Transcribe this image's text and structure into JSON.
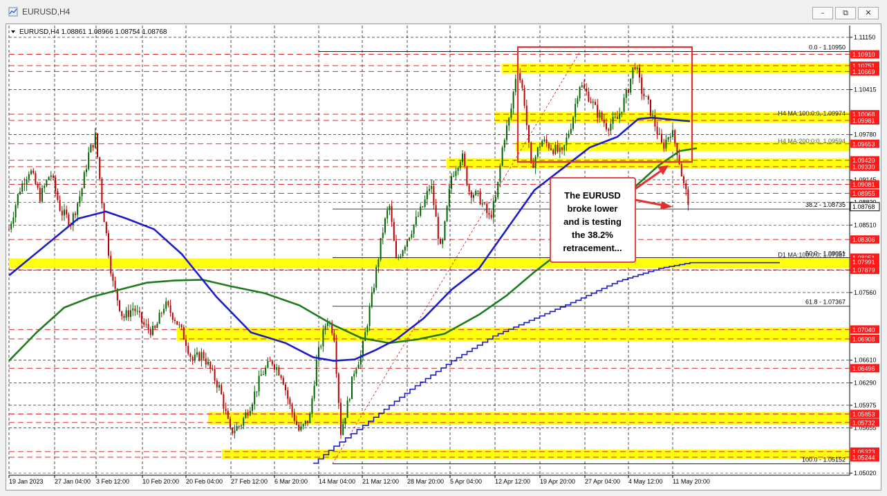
{
  "window": {
    "title": "EURUSD,H4",
    "minimize_label": "–",
    "restore_label": "⧉",
    "close_label": "✕"
  },
  "chart_data": {
    "type": "candlestick",
    "symbol_header": "EURUSD,H4  1.08861 1.08966 1.08754 1.08768",
    "ylim": [
      1.0502,
      1.1111
    ],
    "colors": {
      "up": "#006400",
      "down": "#c00000",
      "ma100": "#1c1cc8",
      "ma200": "#1e7a1e",
      "d1_ma100": "#1c1cc8",
      "zone": "#ffff00",
      "box": "#e03030",
      "arrow": "#e03030"
    },
    "y_ticks": [
      "1.11150",
      "1.10415",
      "1.09780",
      "1.09145",
      "1.08830",
      "1.08510",
      "1.07875",
      "1.07560",
      "1.06610",
      "1.06290",
      "1.05975",
      "1.05655",
      "1.05020"
    ],
    "x_ticks": [
      "19 Jan 2023",
      "27 Jan 04:00",
      "3 Feb 12:00",
      "10 Feb 20:00",
      "20 Feb 04:00",
      "27 Feb 12:00",
      "6 Mar 20:00",
      "14 Mar 04:00",
      "21 Mar 12:00",
      "28 Mar 20:00",
      "5 Apr 04:00",
      "12 Apr 12:00",
      "19 Apr 20:00",
      "27 Apr 04:00",
      "4 May 12:00",
      "11 May 20:00"
    ],
    "price_labels": [
      {
        "text": "1.10910",
        "kind": "red"
      },
      {
        "text": "1.10751",
        "kind": "red"
      },
      {
        "text": "1.10669",
        "kind": "red"
      },
      {
        "text": "1.10068",
        "kind": "red"
      },
      {
        "text": "1.09981",
        "kind": "red"
      },
      {
        "text": "1.09653",
        "kind": "red"
      },
      {
        "text": "1.09420",
        "kind": "red"
      },
      {
        "text": "1.09330",
        "kind": "red"
      },
      {
        "text": "1.09081",
        "kind": "red"
      },
      {
        "text": "1.08955",
        "kind": "red"
      },
      {
        "text": "1.08768",
        "kind": "current"
      },
      {
        "text": "1.08306",
        "kind": "red"
      },
      {
        "text": "1.08051",
        "kind": "red"
      },
      {
        "text": "1.07991",
        "kind": "red"
      },
      {
        "text": "1.07879",
        "kind": "red"
      },
      {
        "text": "1.07040",
        "kind": "red"
      },
      {
        "text": "1.06908",
        "kind": "red"
      },
      {
        "text": "1.06496",
        "kind": "red"
      },
      {
        "text": "1.05853",
        "kind": "red"
      },
      {
        "text": "1.05732",
        "kind": "red"
      },
      {
        "text": "1.05323",
        "kind": "red"
      },
      {
        "text": "1.05244",
        "kind": "red"
      }
    ],
    "fib_levels": [
      {
        "label": "0.0 - 1.10950",
        "price": 1.1095
      },
      {
        "label": "38.2 - 1.08735",
        "price": 1.08735
      },
      {
        "label": "50.0 - 1.08051",
        "price": 1.08051
      },
      {
        "label": "61.8 - 1.07367",
        "price": 1.07367
      },
      {
        "label": "100.0 - 1.05152",
        "price": 1.05152
      }
    ],
    "ma_labels": {
      "h4_ma100": "H4 MA:100:0:0, 1.09974",
      "h4_ma200": "H4 MA:200:0:0, 1.09594",
      "d1_ma100": "D1 MA:100:0:0, 1.07987"
    },
    "zones": [
      {
        "from": 1.10669,
        "to": 1.10751
      },
      {
        "from": 1.09981,
        "to": 1.10068
      },
      {
        "from": 1.09577,
        "to": 1.09653
      },
      {
        "from": 1.0933,
        "to": 1.0942
      },
      {
        "from": 1.07938,
        "to": 1.0801
      },
      {
        "from": 1.06908,
        "to": 1.0704
      },
      {
        "from": 1.05732,
        "to": 1.05853
      },
      {
        "from": 1.05244,
        "to": 1.05323
      }
    ],
    "red_lines": [
      1.1091,
      1.10751,
      1.10669,
      1.10068,
      1.09981,
      1.09653,
      1.0942,
      1.0933,
      1.09081,
      1.08955,
      1.08306,
      1.07879,
      1.0704,
      1.06908,
      1.06496,
      1.05853,
      1.05732,
      1.05323,
      1.05244
    ],
    "close_path": [
      [
        0,
        1.0845
      ],
      [
        15,
        1.09
      ],
      [
        30,
        1.093
      ],
      [
        45,
        1.089
      ],
      [
        60,
        1.0925
      ],
      [
        75,
        1.087
      ],
      [
        90,
        1.0855
      ],
      [
        105,
        1.09
      ],
      [
        115,
        1.095
      ],
      [
        125,
        1.0975
      ],
      [
        135,
        1.088
      ],
      [
        150,
        1.077
      ],
      [
        165,
        1.072
      ],
      [
        180,
        1.0735
      ],
      [
        195,
        1.071
      ],
      [
        210,
        1.07
      ],
      [
        225,
        1.074
      ],
      [
        240,
        1.072
      ],
      [
        255,
        1.069
      ],
      [
        265,
        1.066
      ],
      [
        280,
        1.067
      ],
      [
        295,
        1.064
      ],
      [
        305,
        1.062
      ],
      [
        320,
        1.056
      ],
      [
        335,
        1.057
      ],
      [
        350,
        1.06
      ],
      [
        365,
        1.064
      ],
      [
        380,
        1.066
      ],
      [
        395,
        1.064
      ],
      [
        405,
        1.06
      ],
      [
        420,
        1.056
      ],
      [
        435,
        1.058
      ],
      [
        445,
        1.066
      ],
      [
        460,
        1.072
      ],
      [
        470,
        1.07
      ],
      [
        480,
        1.056
      ],
      [
        490,
        1.06
      ],
      [
        500,
        1.065
      ],
      [
        510,
        1.067
      ],
      [
        525,
        1.075
      ],
      [
        540,
        1.084
      ],
      [
        550,
        1.088
      ],
      [
        560,
        1.08
      ],
      [
        575,
        1.083
      ],
      [
        590,
        1.086
      ],
      [
        600,
        1.088
      ],
      [
        610,
        1.091
      ],
      [
        625,
        1.081
      ],
      [
        640,
        1.092
      ],
      [
        655,
        1.095
      ],
      [
        665,
        1.09
      ],
      [
        680,
        1.089
      ],
      [
        695,
        1.086
      ],
      [
        705,
        1.089
      ],
      [
        715,
        1.097
      ],
      [
        725,
        1.1005
      ],
      [
        735,
        1.1075
      ],
      [
        745,
        1.103
      ],
      [
        755,
        1.093
      ],
      [
        770,
        1.097
      ],
      [
        785,
        1.096
      ],
      [
        800,
        1.095
      ],
      [
        815,
        1.1
      ],
      [
        825,
        1.105
      ],
      [
        840,
        1.103
      ],
      [
        850,
        1.101
      ],
      [
        865,
        1.099
      ],
      [
        880,
        1.1
      ],
      [
        895,
        1.104
      ],
      [
        905,
        1.108
      ],
      [
        915,
        1.104
      ],
      [
        925,
        1.102
      ],
      [
        935,
        1.099
      ],
      [
        945,
        1.096
      ],
      [
        958,
        1.0985
      ],
      [
        968,
        1.095
      ],
      [
        975,
        1.091
      ],
      [
        985,
        1.0877
      ]
    ],
    "ma100_path": [
      [
        0,
        1.078
      ],
      [
        50,
        1.082
      ],
      [
        100,
        1.086
      ],
      [
        140,
        1.087
      ],
      [
        170,
        1.086
      ],
      [
        210,
        1.0845
      ],
      [
        250,
        1.081
      ],
      [
        300,
        1.075
      ],
      [
        350,
        1.07
      ],
      [
        400,
        1.0685
      ],
      [
        440,
        1.0665
      ],
      [
        470,
        1.066
      ],
      [
        500,
        1.0662
      ],
      [
        530,
        1.0675
      ],
      [
        560,
        1.069
      ],
      [
        600,
        1.072
      ],
      [
        640,
        1.076
      ],
      [
        680,
        1.079
      ],
      [
        720,
        1.0845
      ],
      [
        760,
        1.09
      ],
      [
        800,
        1.093
      ],
      [
        840,
        1.096
      ],
      [
        880,
        1.0975
      ],
      [
        910,
        1.1
      ],
      [
        930,
        1.1002
      ],
      [
        960,
        1.0999
      ],
      [
        985,
        1.0997
      ]
    ],
    "ma200_path": [
      [
        0,
        1.066
      ],
      [
        40,
        1.07
      ],
      [
        80,
        1.0735
      ],
      [
        120,
        1.075
      ],
      [
        160,
        1.076
      ],
      [
        200,
        1.077
      ],
      [
        240,
        1.0773
      ],
      [
        280,
        1.0774
      ],
      [
        320,
        1.0765
      ],
      [
        370,
        1.0755
      ],
      [
        420,
        1.0738
      ],
      [
        470,
        1.071
      ],
      [
        510,
        1.0692
      ],
      [
        550,
        1.0685
      ],
      [
        590,
        1.069
      ],
      [
        630,
        1.0698
      ],
      [
        680,
        1.0725
      ],
      [
        720,
        1.0752
      ],
      [
        760,
        1.0785
      ],
      [
        800,
        1.0815
      ],
      [
        850,
        1.085
      ],
      [
        900,
        1.09
      ],
      [
        940,
        1.0935
      ],
      [
        970,
        1.0955
      ],
      [
        995,
        1.0959
      ]
    ],
    "d1ma100_path": [
      [
        440,
        1.0516
      ],
      [
        470,
        1.054
      ],
      [
        520,
        1.0575
      ],
      [
        580,
        1.062
      ],
      [
        640,
        1.066
      ],
      [
        700,
        1.0695
      ],
      [
        760,
        1.072
      ],
      [
        820,
        1.0745
      ],
      [
        880,
        1.0772
      ],
      [
        940,
        1.079
      ],
      [
        985,
        1.0798
      ],
      [
        1115,
        1.0798
      ]
    ],
    "annotation": {
      "lines": [
        "The EURUSD",
        "broke lower",
        "and is testing",
        "the 38.2%",
        "retracement..."
      ]
    }
  }
}
